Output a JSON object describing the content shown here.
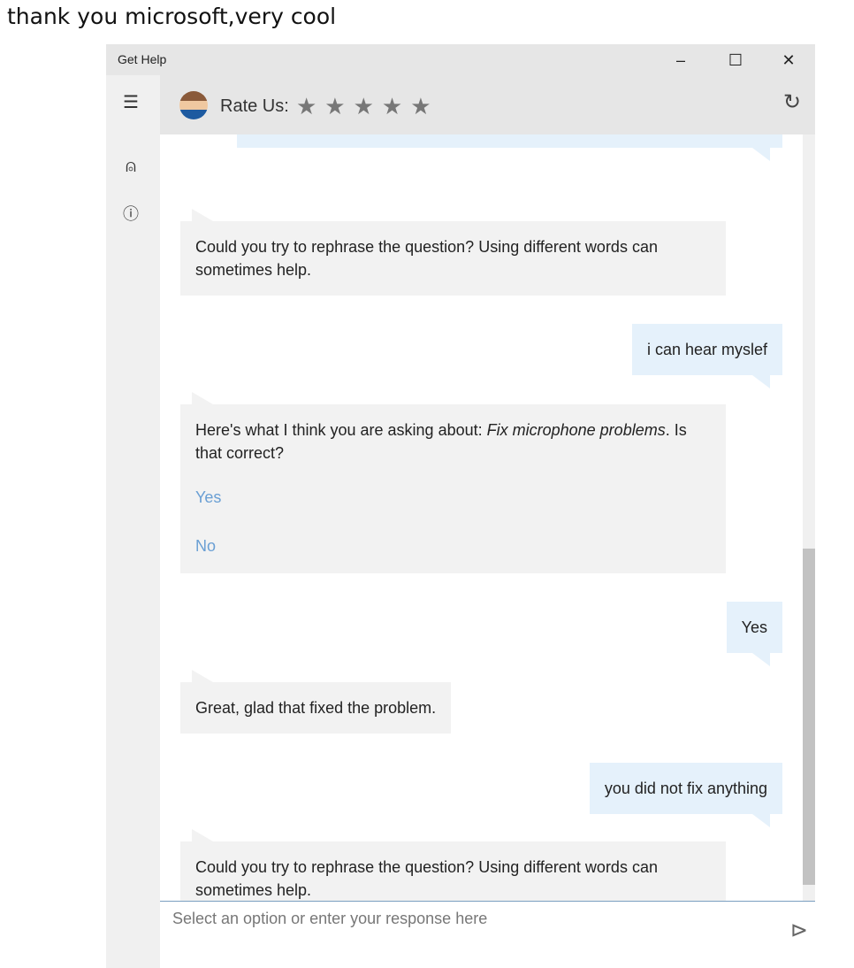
{
  "caption": "thank you microsoft,very cool",
  "window": {
    "title": "Get Help",
    "minimize": "–",
    "maximize": "☐",
    "close": "✕"
  },
  "header": {
    "rate_label": "Rate Us:",
    "stars": "★★★★★",
    "star_rating": 0
  },
  "messages": [
    {
      "from": "bot",
      "text": "Could you try to rephrase the question? Using different words can sometimes help."
    },
    {
      "from": "user",
      "text": "i can hear myslef"
    },
    {
      "from": "bot",
      "text_prefix": "Here's what I think you are asking about: ",
      "text_italic": "Fix microphone problems",
      "text_suffix": ". Is that correct?",
      "options": [
        "Yes",
        "No"
      ]
    },
    {
      "from": "user",
      "text": "Yes"
    },
    {
      "from": "bot",
      "text": "Great, glad that fixed the problem."
    },
    {
      "from": "user",
      "text": "you did not fix anything"
    },
    {
      "from": "bot",
      "text": "Could you try to rephrase the question? Using different words can sometimes help."
    }
  ],
  "input": {
    "placeholder": "Select an option or enter your response here",
    "value": ""
  },
  "colors": {
    "user_bubble": "#e5f1fb",
    "bot_bubble": "#f2f2f2",
    "link": "#6a9fd4"
  }
}
